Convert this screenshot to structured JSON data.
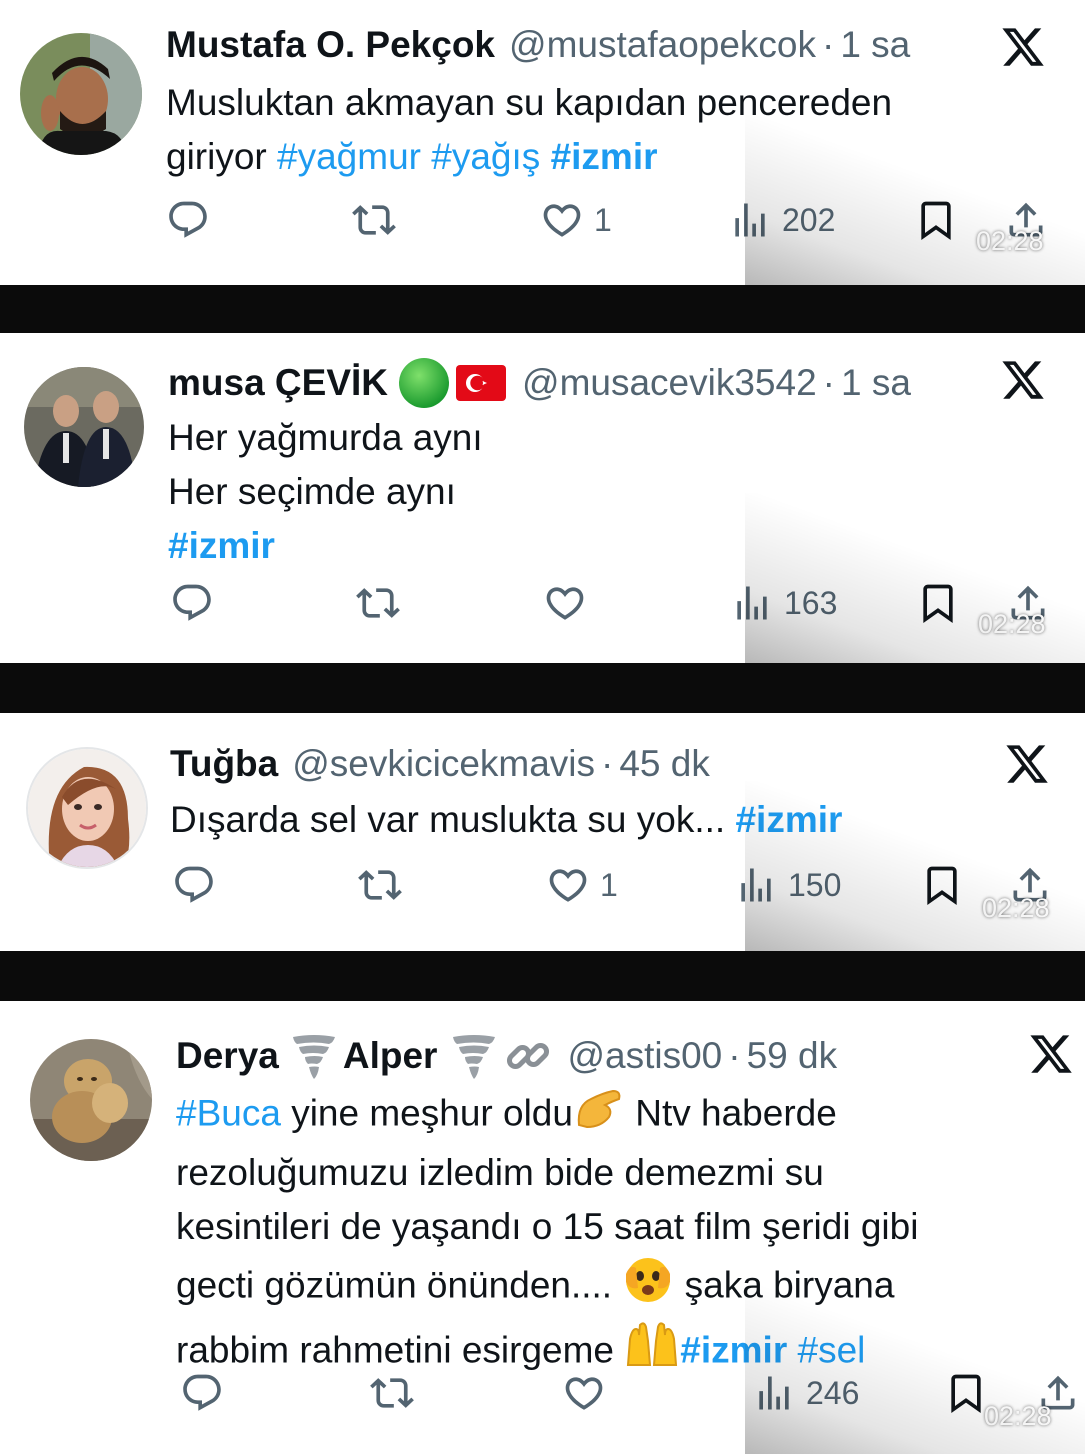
{
  "tweets": [
    {
      "name": "Mustafa O. Pekçok",
      "handle": "@mustafaopekcok",
      "time": "1 sa",
      "lines": [
        [
          {
            "t": "Musluktan akmayan su kapıdan pencereden",
            "k": "txt"
          }
        ],
        [
          {
            "t": "giriyor ",
            "k": "txt"
          },
          {
            "t": "#yağmur",
            "k": "tag"
          },
          {
            "t": " ",
            "k": "txt"
          },
          {
            "t": "#yağış",
            "k": "tag"
          },
          {
            "t": " ",
            "k": "txt"
          },
          {
            "t": "#izmir",
            "k": "tagb"
          }
        ]
      ],
      "likes": "1",
      "views": "202",
      "stamp": "02:28"
    },
    {
      "name": "musa ÇEVİK",
      "handle": "@musacevik3542",
      "time": "1 sa",
      "lines": [
        [
          {
            "t": "Her yağmurda aynı",
            "k": "txt"
          }
        ],
        [
          {
            "t": "Her seçimde aynı",
            "k": "txt"
          }
        ],
        [
          {
            "t": "#izmir",
            "k": "tagb"
          }
        ]
      ],
      "likes": "",
      "views": "163",
      "stamp": "02:28"
    },
    {
      "name": "Tuğba",
      "handle": "@sevkicicekmavis",
      "time": "45 dk",
      "lines": [
        [
          {
            "t": "Dışarda sel var muslukta su yok... ",
            "k": "txt"
          },
          {
            "t": "#izmir",
            "k": "tagb"
          }
        ]
      ],
      "likes": "1",
      "views": "150",
      "stamp": "02:28"
    },
    {
      "name": "Derya",
      "name2": "Alper",
      "handle": "@astis00",
      "time": "59 dk",
      "lines": [
        [
          {
            "t": "#Buca",
            "k": "tag"
          },
          {
            "t": " yine meşhur oldu",
            "k": "txt"
          },
          {
            "t": "pinch",
            "k": "emoji"
          },
          {
            "t": " Ntv haberde",
            "k": "txt"
          }
        ],
        [
          {
            "t": "rezoluğumuzu izledim bide demezmi su",
            "k": "txt"
          }
        ],
        [
          {
            "t": "kesintileri de yaşandı o 15 saat film şeridi gibi",
            "k": "txt"
          }
        ],
        [
          {
            "t": "gecti gözümün önünden.... ",
            "k": "txt"
          },
          {
            "t": "peek",
            "k": "emoji"
          },
          {
            "t": " şaka biryana",
            "k": "txt"
          }
        ],
        [
          {
            "t": "rabbim rahmetini esirgeme ",
            "k": "txt"
          },
          {
            "t": "palms",
            "k": "emoji"
          },
          {
            "t": "#izmir",
            "k": "tagb"
          },
          {
            "t": " ",
            "k": "txt"
          },
          {
            "t": "#sel",
            "k": "tag"
          }
        ]
      ],
      "likes": "",
      "views": "246",
      "stamp": "02:28"
    }
  ],
  "colors": {
    "link": "#1d9bf0",
    "muted": "#536471",
    "divider": "#0b0b0b",
    "verified": "#22b14c",
    "flag": "#e30a17"
  }
}
